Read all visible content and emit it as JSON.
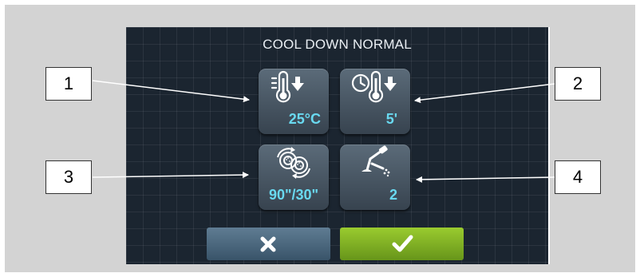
{
  "screen": {
    "title": "COOL DOWN NORMAL"
  },
  "tiles": [
    {
      "value": "25°C",
      "icon": "thermometer-down-icon"
    },
    {
      "value": "5'",
      "icon": "clock-thermometer-icon"
    },
    {
      "value": "90\"/30\"",
      "icon": "drum-rotation-icon"
    },
    {
      "value": "2",
      "icon": "valve-level-icon"
    }
  ],
  "buttons": {
    "cancel_icon": "close-icon",
    "confirm_icon": "check-icon"
  },
  "callouts": [
    "1",
    "2",
    "3",
    "4"
  ],
  "colors": {
    "value_text": "#69d9f0",
    "confirm": "#7fb224",
    "cancel": "#4a667c",
    "screen_bg": "#1b2530"
  }
}
